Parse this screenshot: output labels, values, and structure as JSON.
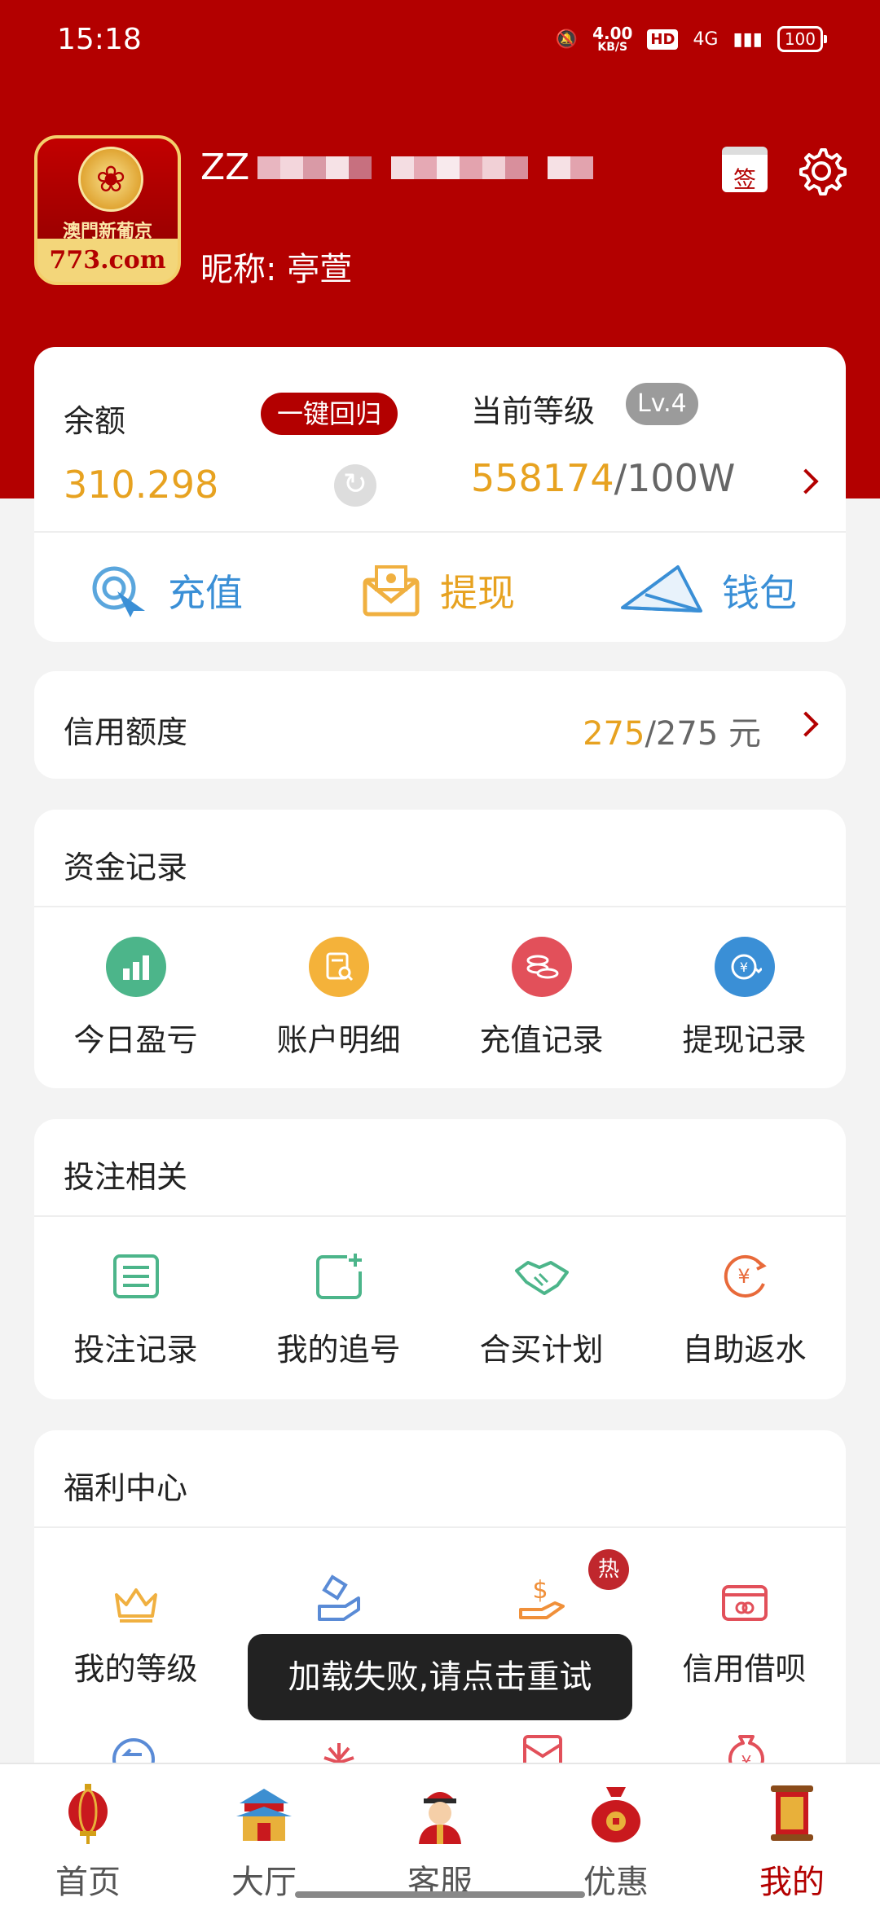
{
  "status_bar": {
    "time": "15:18",
    "netspeed_value": "4.00",
    "netspeed_unit": "KB/S",
    "hd": "HD",
    "network": "4G",
    "battery": "100"
  },
  "profile": {
    "logo_cn": "澳門新葡京",
    "logo_domain": "773.com",
    "username_prefix": "ZZ",
    "nickname": "昵称: 亭萱",
    "sign_label": "签"
  },
  "balance": {
    "label": "余额",
    "return_button": "一键回归",
    "value": "310.298",
    "level_label": "当前等级",
    "level_badge": "Lv.4",
    "level_current": "558174",
    "level_target": "/100W"
  },
  "actions": [
    {
      "label": "充值"
    },
    {
      "label": "提现"
    },
    {
      "label": "钱包"
    }
  ],
  "credit": {
    "label": "信用额度",
    "current": "275",
    "total": "/275 元"
  },
  "fund_records": {
    "title": "资金记录",
    "items": [
      {
        "label": "今日盈亏"
      },
      {
        "label": "账户明细"
      },
      {
        "label": "充值记录"
      },
      {
        "label": "提现记录"
      }
    ]
  },
  "bet_related": {
    "title": "投注相关",
    "items": [
      {
        "label": "投注记录"
      },
      {
        "label": "我的追号"
      },
      {
        "label": "合买计划"
      },
      {
        "label": "自助返水"
      }
    ]
  },
  "welfare": {
    "title": "福利中心",
    "items": [
      {
        "label": "我的等级"
      },
      {
        "label": "信用借呗"
      }
    ],
    "hot_badge": "热"
  },
  "toast": "加载失败,请点击重试",
  "bottom_nav": [
    {
      "label": "首页"
    },
    {
      "label": "大厅"
    },
    {
      "label": "客服"
    },
    {
      "label": "优惠"
    },
    {
      "label": "我的"
    }
  ],
  "colors": {
    "brand_red": "#b30000",
    "accent_gold": "#e7a220",
    "action_blue": "#3a8fd6"
  }
}
